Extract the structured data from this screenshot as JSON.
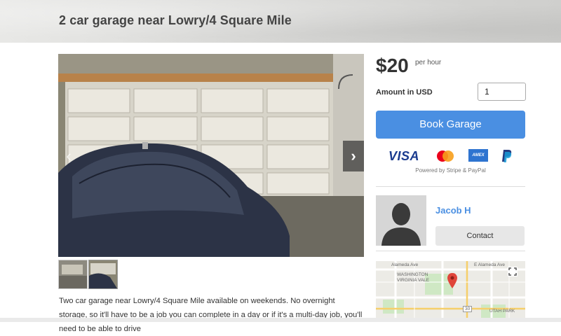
{
  "header": {
    "title": "2 car garage near Lowry/4 Square Mile"
  },
  "gallery": {
    "prev_label": "‹",
    "next_label": "›",
    "image_description": "garage interior photo"
  },
  "description": {
    "text": "Two car garage near Lowry/4 Square Mile available on weekends. No overnight storage, so it'll have to be a job you can complete in a day or if it's a multi-day job, you'll need to be able to drive"
  },
  "booking": {
    "price": "$20",
    "price_unit": "per hour",
    "amount_label": "Amount in USD",
    "amount_value": "1",
    "book_label": "Book Garage",
    "powered_by": "Powered by Stripe & PayPal",
    "payment_icons": [
      "visa",
      "mastercard",
      "amex",
      "paypal"
    ],
    "visa_text": "VISA",
    "amex_text": "AMEX"
  },
  "host": {
    "name": "Jacob H",
    "contact_label": "Contact"
  },
  "map": {
    "labels": {
      "alameda_top": "E Alameda Ave",
      "alameda_left": "Alameda Ave",
      "washington": "WASHINGTON",
      "virginia_vale": "VIRGINIA VALE",
      "utah_park": "UTAH PARK",
      "route": "30"
    }
  },
  "colors": {
    "accent": "#4a8fe2",
    "visa": "#1a3b8f",
    "amex": "#2e74d0",
    "map_pin": "#e0453a"
  }
}
